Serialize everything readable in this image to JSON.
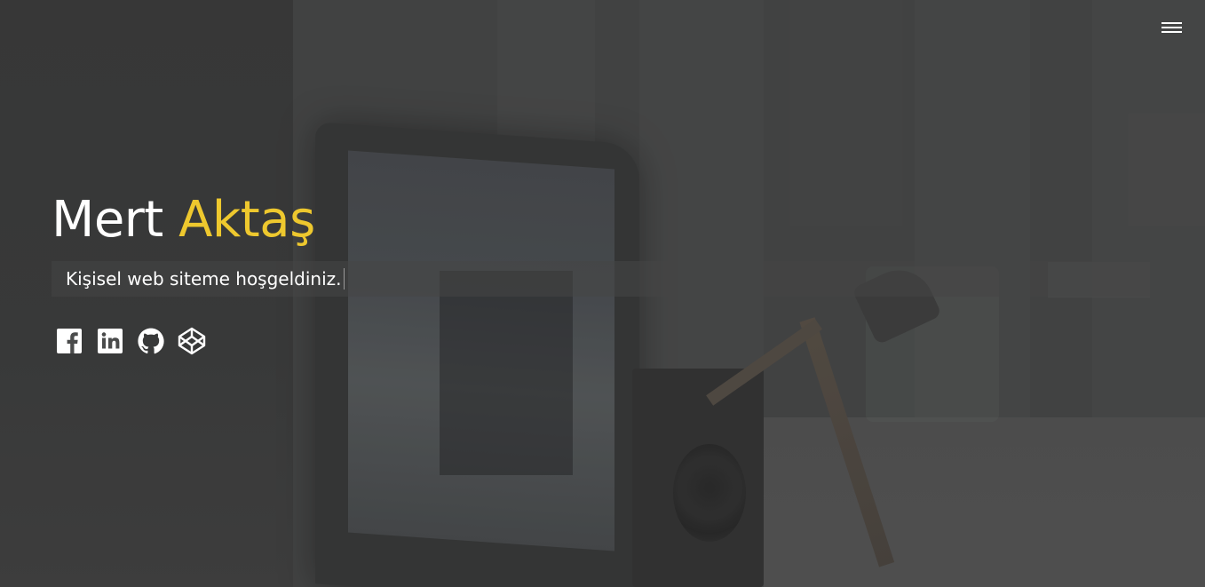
{
  "header": {
    "menu_icon": "hamburger-menu-icon"
  },
  "intro": {
    "first_name": "Mert",
    "last_name": "Aktaş",
    "tagline": "Kişisel web siteme hoşgeldiniz."
  },
  "socials": [
    {
      "name": "Facebook",
      "icon": "facebook-icon"
    },
    {
      "name": "LinkedIn",
      "icon": "linkedin-icon"
    },
    {
      "name": "GitHub",
      "icon": "github-icon"
    },
    {
      "name": "CodePen",
      "icon": "codepen-icon"
    }
  ],
  "colors": {
    "accent": "#eec82e",
    "text": "#ffffff",
    "background": "#4a4b4b"
  }
}
